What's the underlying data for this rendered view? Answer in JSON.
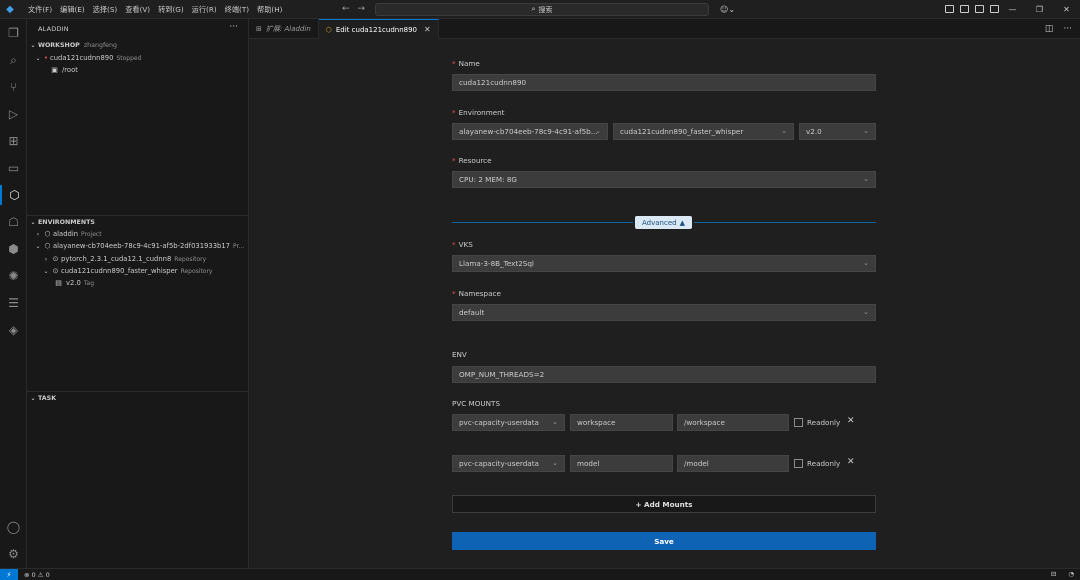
{
  "menu": [
    "文件(F)",
    "编辑(E)",
    "选择(S)",
    "查看(V)",
    "转到(G)",
    "运行(R)",
    "终端(T)",
    "帮助(H)"
  ],
  "search": {
    "label": "搜索"
  },
  "sidebar": {
    "title": "ALADDIN",
    "workshop": {
      "header": "WORKSHOP",
      "user": "zhangfeng",
      "item": {
        "name": "cuda121cudnn890",
        "status": "Stopped"
      },
      "child": "/root"
    },
    "environments": {
      "header": "ENVIRONMENTS",
      "items": [
        {
          "name": "aladdin",
          "desc": "Project"
        },
        {
          "name": "alayanew-cb704eeb-78c9-4c91-af5b-2df031933b17",
          "desc": "Pr..."
        },
        {
          "name": "pytorch_2.3.1_cuda12.1_cudnn8",
          "desc": "Repository"
        },
        {
          "name": "cuda121cudnn890_faster_whisper",
          "desc": "Repository"
        },
        {
          "name": "v2.0",
          "desc": "Tag"
        }
      ]
    },
    "task": {
      "header": "TASK"
    }
  },
  "tabs": [
    {
      "label": "扩展: Aladdin"
    },
    {
      "label": "Edit cuda121cudnn890"
    }
  ],
  "form": {
    "name_label": "Name",
    "name_value": "cuda121cudnn890",
    "env_label": "Environment",
    "env_project": "alayanew-cb704eeb-78c9-4c91-af5b...",
    "env_repo": "cuda121cudnn890_faster_whisper",
    "env_tag": "v2.0",
    "resource_label": "Resource",
    "resource_value": "CPU: 2 MEM: 8G",
    "advanced_label": "Advanced",
    "vks_label": "VKS",
    "vks_value": "Llama-3-8B_Text2Sql",
    "namespace_label": "Namespace",
    "namespace_value": "default",
    "env_section_label": "ENV",
    "env_value": "OMP_NUM_THREADS=2",
    "pvc_label": "PVC MOUNTS",
    "mounts": [
      {
        "pvc": "pvc-capacity-userdata",
        "sub": "workspace",
        "path": "/workspace",
        "readonly": "Readonly"
      },
      {
        "pvc": "pvc-capacity-userdata",
        "sub": "model",
        "path": "/model",
        "readonly": "Readonly"
      }
    ],
    "add_mounts": "+ Add Mounts",
    "save": "Save"
  },
  "status": {
    "problems": "⊗ 0 ⚠ 0"
  },
  "colors": {
    "accent": "#0078d4",
    "save": "#0e63b5",
    "required": "#f14c4c"
  }
}
